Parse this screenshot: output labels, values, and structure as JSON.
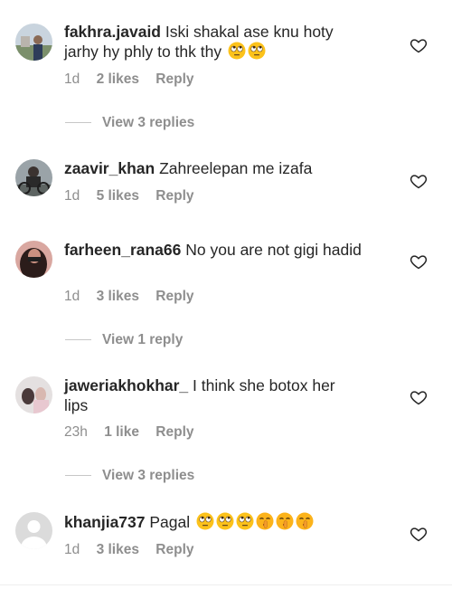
{
  "comments": [
    {
      "username": "fakhra.javaid",
      "text": "Iski shakal ase knu hoty jarhy hy phly to thk thy",
      "emojis": [
        "face-with-rolling-eyes-emoji",
        "face-with-rolling-eyes-emoji"
      ],
      "time": "1d",
      "likes": "2 likes",
      "reply": "Reply",
      "view_replies": "View 3 replies"
    },
    {
      "username": "zaavir_khan",
      "text": "Zahreelepan me izafa",
      "emojis": [],
      "time": "1d",
      "likes": "5 likes",
      "reply": "Reply",
      "view_replies": ""
    },
    {
      "username": "farheen_rana66",
      "text": "No you are not gigi hadid",
      "emojis": [],
      "time": "1d",
      "likes": "3 likes",
      "reply": "Reply",
      "view_replies": "View 1 reply"
    },
    {
      "username": "jaweriakhokhar_",
      "text": "I think she botox her lips",
      "emojis": [],
      "time": "23h",
      "likes": "1 like",
      "reply": "Reply",
      "view_replies": "View 3 replies"
    },
    {
      "username": "khanjia737",
      "text": "Pagal",
      "emojis": [
        "face-with-rolling-eyes-emoji",
        "face-with-rolling-eyes-emoji",
        "face-with-rolling-eyes-emoji",
        "shushing-face-emoji",
        "shushing-face-emoji",
        "shushing-face-emoji"
      ],
      "time": "1d",
      "likes": "3 likes",
      "reply": "Reply",
      "view_replies": ""
    }
  ],
  "colors": {
    "username": "#262626",
    "meta": "#8e8e8e",
    "divider": "#c7c7c7",
    "emoji_face": "#fcc21b"
  },
  "icons": {
    "like": "heart-outline-icon"
  }
}
